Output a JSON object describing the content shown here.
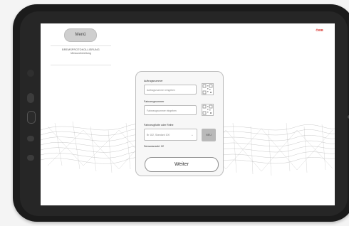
{
  "header": {
    "menu_label": "Menü",
    "brand_logo": "ÖBB"
  },
  "sidebar": {
    "items": [
      {
        "title": "BREMSPROTOKOLLIERUNG",
        "subtitle": "Messvorbereitung"
      }
    ]
  },
  "form": {
    "order_number": {
      "label": "Auftragsnummer",
      "placeholder": "Auftragsnummer eingeben"
    },
    "vehicle_number": {
      "label": "Fahrzeugnummer",
      "placeholder": "Fahrzeugnummer eingeben"
    },
    "fleet": {
      "label": "Fahrzeugflotte oder Reihe",
      "selected": "Br 182, Standard 100",
      "new_label": "NEU"
    },
    "sensor_count_label": "Sensoranzahl: 02",
    "continue_label": "Weiter"
  },
  "icons": [
    "qr-code-icon",
    "chevron-down-icon"
  ],
  "colors": {
    "brand": "#d8322b",
    "menu_button": "#cfcfcf",
    "new_button": "#b9b9b9"
  }
}
